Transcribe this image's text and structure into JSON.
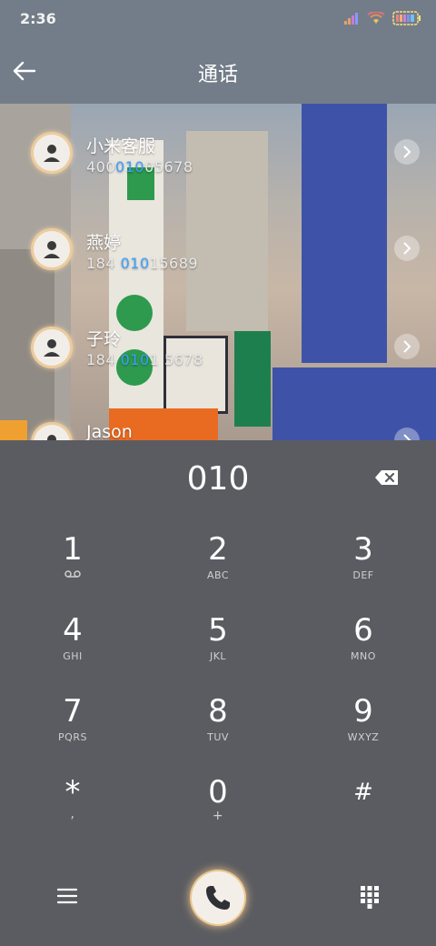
{
  "status": {
    "time": "2:36"
  },
  "header": {
    "title": "通话"
  },
  "results": [
    {
      "name": "小米客服",
      "num_pre": "400",
      "num_hl": "010",
      "num_post": "05678"
    },
    {
      "name": "燕婷",
      "num_pre": "184 ",
      "num_hl": "010",
      "num_post": "15689"
    },
    {
      "name": "子玲",
      "num_pre": "184 ",
      "num_hl": "010",
      "num_post": "1 5678"
    },
    {
      "name": "Jason",
      "num_pre": "",
      "num_hl": "",
      "num_post": ""
    }
  ],
  "dialer": {
    "input": "010",
    "keys": [
      {
        "d": "1",
        "s": "voicemail"
      },
      {
        "d": "2",
        "s": "ABC"
      },
      {
        "d": "3",
        "s": "DEF"
      },
      {
        "d": "4",
        "s": "GHI"
      },
      {
        "d": "5",
        "s": "JKL"
      },
      {
        "d": "6",
        "s": "MNO"
      },
      {
        "d": "7",
        "s": "PQRS"
      },
      {
        "d": "8",
        "s": "TUV"
      },
      {
        "d": "9",
        "s": "WXYZ"
      },
      {
        "d": "*",
        "s": ","
      },
      {
        "d": "0",
        "s": "+"
      },
      {
        "d": "#",
        "s": ""
      }
    ]
  },
  "colors": {
    "highlight": "#3aa0ff",
    "appbar": "#737d89",
    "dialer_bg": "#5b5c61"
  },
  "icons": {
    "back": "back-arrow-icon",
    "delete": "backspace-icon",
    "menu": "menu-icon",
    "call": "phone-icon",
    "keypad": "dialpad-icon"
  }
}
